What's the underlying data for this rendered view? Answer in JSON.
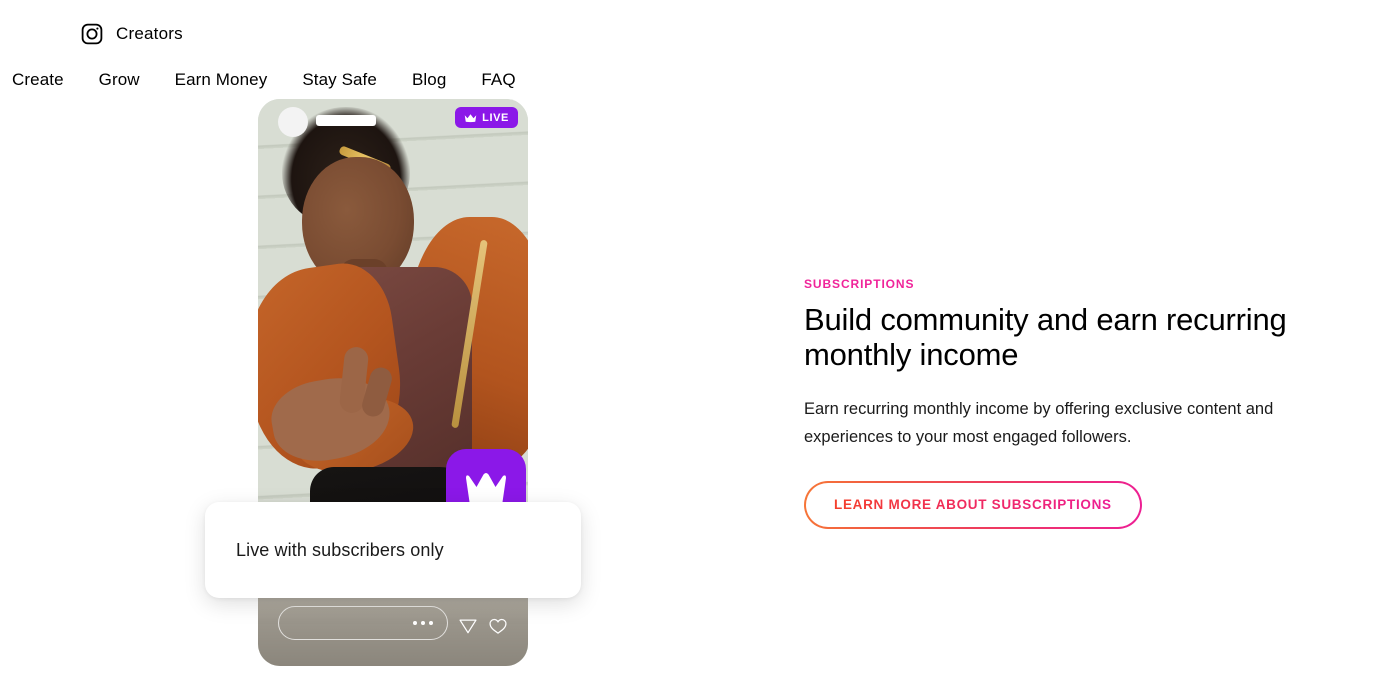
{
  "header": {
    "brand_icon": "instagram-icon",
    "brand_label": "Creators",
    "nav_items": [
      {
        "label": "Create"
      },
      {
        "label": "Grow"
      },
      {
        "label": "Earn Money"
      },
      {
        "label": "Stay Safe"
      },
      {
        "label": "Blog"
      },
      {
        "label": "FAQ"
      }
    ]
  },
  "phone": {
    "live_badge": {
      "icon": "crown-icon",
      "label": "LIVE"
    },
    "crown_tile_icon": "crown-icon",
    "comment_placeholder_icon": "ellipsis-icon",
    "send_icon": "send-icon",
    "like_icon": "heart-icon",
    "avatar": "avatar"
  },
  "callout": {
    "text": "Live with subscribers only"
  },
  "content": {
    "eyebrow": "SUBSCRIPTIONS",
    "headline": "Build community and earn recurring monthly income",
    "body": "Earn recurring monthly income by offering exclusive content and experiences to your most engaged followers.",
    "cta_label": "LEARN MORE ABOUT SUBSCRIPTIONS"
  },
  "colors": {
    "eyebrow_pink": "#F0249A",
    "cta_gradient_start": "#F77737",
    "cta_gradient_end": "#ED1E95",
    "live_purple": "#8B18E8",
    "page_background": "#FFFFFF"
  }
}
